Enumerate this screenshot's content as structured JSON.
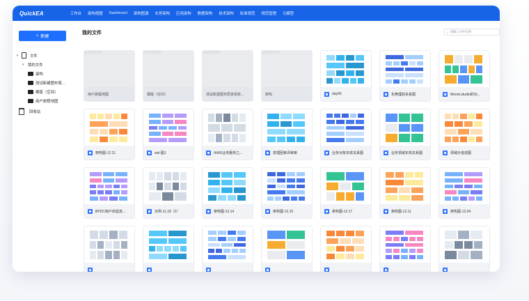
{
  "app": {
    "logo": "QuickEA"
  },
  "nav": [
    "工作台",
    "架构视图",
    "Dashboard",
    "架构图谱",
    "业务架构",
    "应用架构",
    "数据架构",
    "技术架构",
    "标准规范",
    "规范管理",
    "元模型"
  ],
  "sidebar": {
    "new_label": "新建",
    "new_icon": "plus-icon",
    "items": [
      {
        "label": "文件",
        "level": 0
      },
      {
        "label": "我的文件",
        "level": 1
      },
      {
        "label": "架构",
        "level": 2
      },
      {
        "label": "测试新建图布局...",
        "level": 2
      },
      {
        "label": "模版（空间）",
        "level": 2
      },
      {
        "label": "用户旅程地图",
        "level": 2
      },
      {
        "label": "回收站",
        "level": 0
      }
    ]
  },
  "main": {
    "title": "我的文件",
    "search_placeholder": "请输入文件名称",
    "cards": [
      {
        "type": "folder",
        "label": "用户旅程地图"
      },
      {
        "type": "folder",
        "label": "模版（空间）"
      },
      {
        "type": "folder",
        "label": "测试新建图布局查看新..."
      },
      {
        "type": "folder",
        "label": "架构"
      },
      {
        "type": "file",
        "label": "day05"
      },
      {
        "type": "file",
        "label": "东莞理财关系图"
      },
      {
        "type": "file",
        "label": "Monet.studio的功..."
      },
      {
        "type": "file",
        "label": "架构图-12.21"
      },
      {
        "type": "file",
        "label": "wsl-图1"
      },
      {
        "type": "file",
        "label": "IAMS业务服务之..."
      },
      {
        "type": "file",
        "label": "变理团审评审审"
      },
      {
        "type": "file",
        "label": "业务对象实体关系图"
      },
      {
        "type": "file",
        "label": "业务领域实体关系图"
      },
      {
        "type": "file",
        "label": "领域价值流图"
      },
      {
        "type": "file",
        "label": "BPDC用户体验流..."
      },
      {
        "type": "file",
        "label": "示例-11.18（2）"
      },
      {
        "type": "file",
        "label": "架构图-12.14"
      },
      {
        "type": "file",
        "label": "架构图-12.15"
      },
      {
        "type": "file",
        "label": "架构图-12.17"
      },
      {
        "type": "file",
        "label": "架构图-12.11"
      },
      {
        "type": "file",
        "label": "架构图-12.04"
      },
      {
        "type": "file",
        "label": ""
      },
      {
        "type": "file",
        "label": ""
      },
      {
        "type": "file",
        "label": ""
      },
      {
        "type": "file",
        "label": ""
      },
      {
        "type": "file",
        "label": ""
      },
      {
        "type": "file",
        "label": ""
      },
      {
        "type": "file",
        "label": ""
      }
    ]
  },
  "colors": {
    "brand": "#1764e8",
    "button": "#1f6fff",
    "file_icon": "#2f72ff"
  }
}
